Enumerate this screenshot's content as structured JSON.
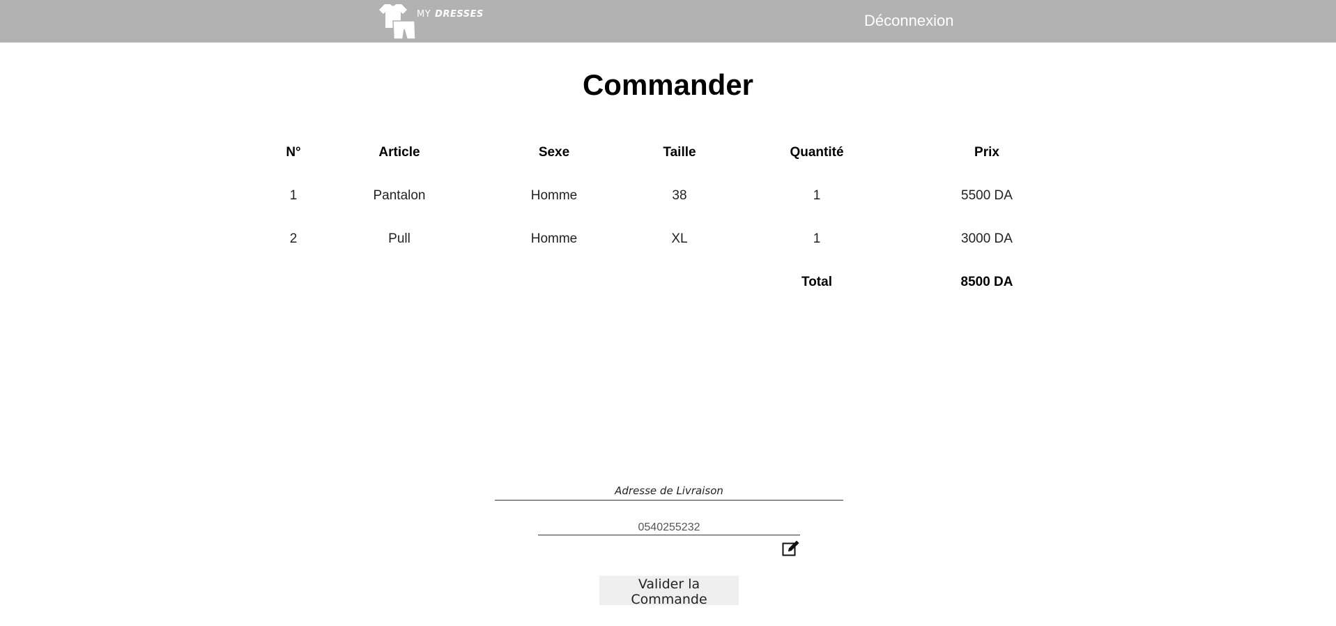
{
  "header": {
    "logo_my": "MY",
    "logo_brand": "DRESSES",
    "logout_label": "Déconnexion"
  },
  "page": {
    "title": "Commander"
  },
  "table": {
    "headers": [
      "N°",
      "Article",
      "Sexe",
      "Taille",
      "Quantité",
      "Prix"
    ],
    "rows": [
      [
        "1",
        "Pantalon",
        "Homme",
        "38",
        "1",
        "5500 DA"
      ],
      [
        "2",
        "Pull",
        "Homme",
        "XL",
        "1",
        "3000 DA"
      ]
    ],
    "total_label": "Total",
    "total_value": "8500 DA"
  },
  "form": {
    "address_placeholder": "Adresse de Livraison",
    "phone_value": "0540255232",
    "submit_label": "Valider la Commande"
  },
  "colors": {
    "header_bg": "#b2b2b2",
    "button_bg": "#efefef"
  }
}
